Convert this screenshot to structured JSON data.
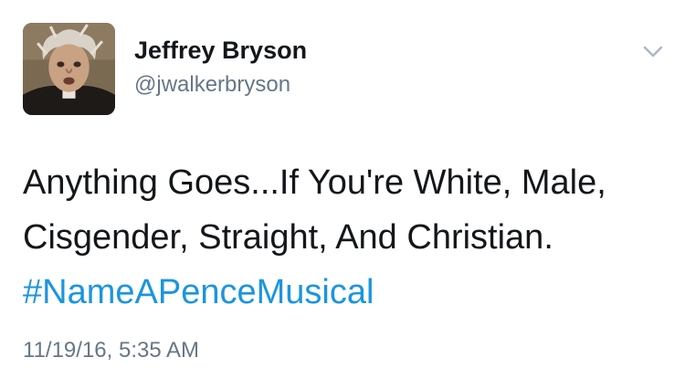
{
  "author": {
    "display_name": "Jeffrey Bryson",
    "handle": "@jwalkerbryson",
    "avatar_icon": "profile-photo"
  },
  "menu": {
    "icon": "chevron-down-icon",
    "color": "#aab8c2"
  },
  "tweet": {
    "lines": [
      "Anything Goes...If You're White, Male,",
      "Cisgender, Straight, And Christian."
    ],
    "hashtag": "#NameAPenceMusical",
    "timestamp": "11/19/16, 5:35 AM"
  },
  "colors": {
    "text": "#14171a",
    "secondary": "#657786",
    "link": "#1b95e0"
  }
}
